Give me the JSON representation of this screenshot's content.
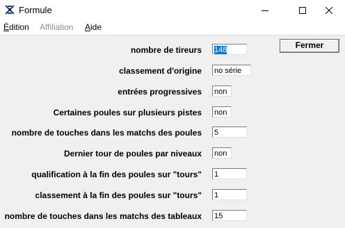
{
  "window": {
    "title": "Formule"
  },
  "menu": [
    {
      "label": "Édition",
      "underline": "É",
      "rest": "dition",
      "disabled": false
    },
    {
      "label": "Affiliation",
      "disabled": true
    },
    {
      "label": "Aide",
      "underline": "A",
      "rest": "ide",
      "disabled": false
    }
  ],
  "buttons": {
    "close_label": "Fermer"
  },
  "rows": [
    {
      "label": "nombre de tireurs",
      "value": "148"
    },
    {
      "label": "classement d'origine",
      "value": "no série"
    },
    {
      "label": "entrées progressives",
      "value": "non"
    },
    {
      "label": "Certaines poules sur plusieurs pistes",
      "value": "non"
    },
    {
      "label": "nombre de touches dans les matchs des poules",
      "value": "5"
    },
    {
      "label": "Dernier tour de poules par niveaux",
      "value": "non"
    },
    {
      "label": "qualification à la fin des poules sur \"tours\"",
      "value": "1"
    },
    {
      "label": "classement à la fin des poules sur \"tours\"",
      "value": "1"
    },
    {
      "label": "nombre de touches dans les matchs des tableaux",
      "value": "15"
    }
  ],
  "colors": {
    "selection": "#0078d7",
    "background": "#f0f0f0"
  }
}
